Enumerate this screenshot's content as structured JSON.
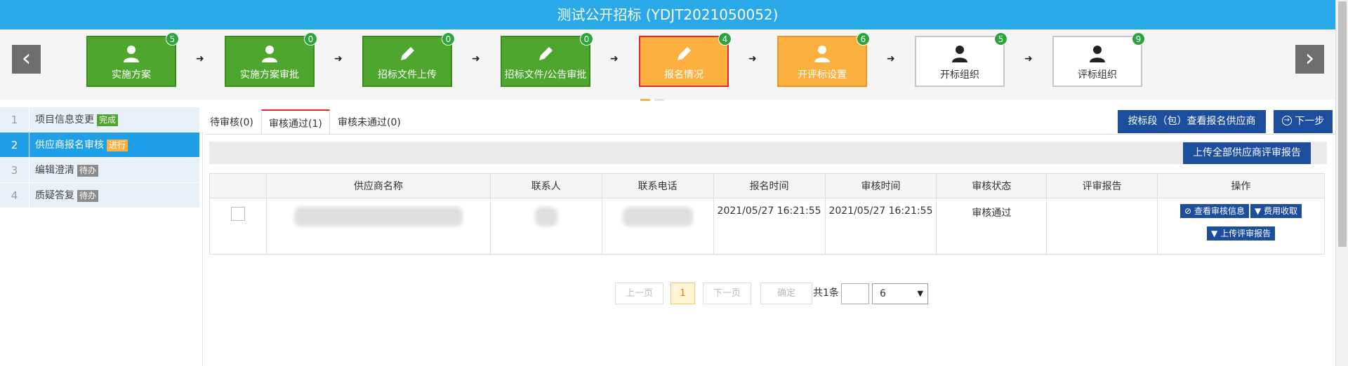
{
  "window": {
    "title": "测试公开招标 (YDJT2021050052)"
  },
  "steps": [
    {
      "label": "实施方案",
      "badge": "5",
      "icon": "user-icon",
      "style": "green"
    },
    {
      "label": "实施方案审批",
      "badge": "0",
      "icon": "user-icon",
      "style": "green"
    },
    {
      "label": "招标文件上传",
      "badge": "0",
      "icon": "pencil-icon",
      "style": "green"
    },
    {
      "label": "招标文件/公告审批",
      "badge": "0",
      "icon": "pencil-icon",
      "style": "green"
    },
    {
      "label": "报名情况",
      "badge": "4",
      "icon": "pencil-icon",
      "style": "orange-active"
    },
    {
      "label": "开评标设置",
      "badge": "6",
      "icon": "user-icon",
      "style": "orange"
    },
    {
      "label": "开标组织",
      "badge": "5",
      "icon": "user-icon",
      "style": "white"
    },
    {
      "label": "评标组织",
      "badge": "9",
      "icon": "user-icon",
      "style": "white"
    }
  ],
  "nav": {
    "prev": "‹",
    "next": "›",
    "step_arrow": "➜"
  },
  "sidebar": {
    "items": [
      {
        "num": "1",
        "label": "项目信息变更",
        "tag": "完成"
      },
      {
        "num": "2",
        "label": "供应商报名审核",
        "tag": "进行"
      },
      {
        "num": "3",
        "label": "编辑澄清",
        "tag": "待办"
      },
      {
        "num": "4",
        "label": "质疑答复",
        "tag": "待办"
      }
    ]
  },
  "tabs": [
    {
      "label": "待审核(0)"
    },
    {
      "label": "审核通过(1)"
    },
    {
      "label": "审核未通过(0)"
    }
  ],
  "actions": {
    "view_by_section": "按标段（包）查看报名供应商",
    "next_step": "下一步",
    "upload_all_reports": "上传全部供应商评审报告"
  },
  "table": {
    "headers": [
      "",
      "供应商名称",
      "联系人",
      "联系电话",
      "报名时间",
      "审核时间",
      "审核状态",
      "评审报告",
      "操作"
    ],
    "rows": [
      {
        "signup_time": "2021/05/27 16:21:55",
        "review_time": "2021/05/27 16:21:55",
        "status": "审核通过",
        "report": "",
        "ops": {
          "view": "查看审核信息",
          "fee": "费用收取",
          "upload": "上传评审报告"
        }
      }
    ]
  },
  "pagination": {
    "prev": "上一页",
    "current": "1",
    "next": "下一页",
    "confirm": "确定",
    "total": "共1条",
    "page_size": "6"
  },
  "colors": {
    "header": "#2aa9e8",
    "green": "#4ea62e",
    "orange": "#fbb040",
    "active_border": "#e3262f",
    "button": "#1d4e9e",
    "sidebar_active": "#1e9fe8"
  }
}
